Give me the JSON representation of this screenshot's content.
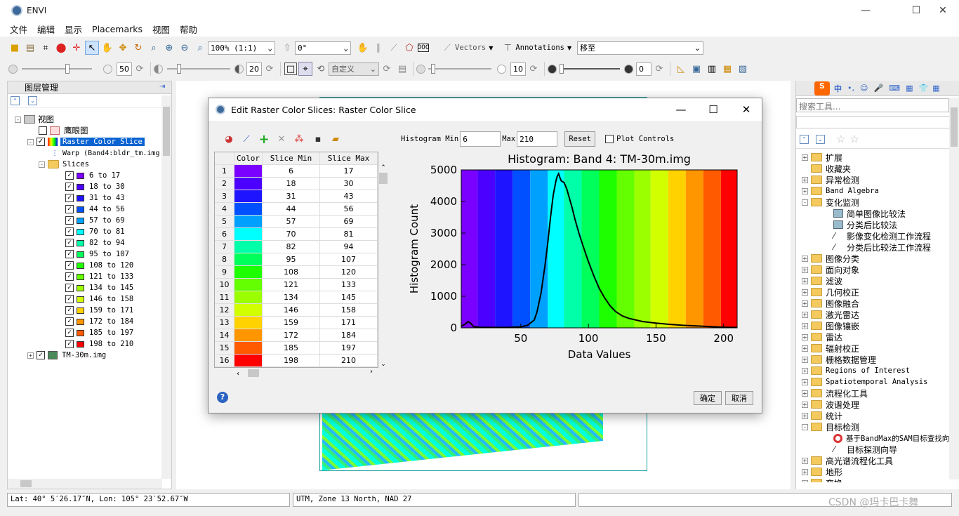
{
  "app": {
    "title": "ENVI"
  },
  "menu": [
    "文件",
    "编辑",
    "显示",
    "Placemarks",
    "视图",
    "帮助"
  ],
  "toolbar": {
    "zoom": "100% (1:1)",
    "rotation": "0°",
    "vectors": "Vectors",
    "annotations": "Annotations",
    "mode": "移至"
  },
  "toolbar2": {
    "brightness": "50",
    "contrast": "20",
    "stretch": "自定义",
    "sharpen": "10",
    "transparency": "0"
  },
  "layers": {
    "title": "图层管理",
    "root": "视图",
    "overview": "鹰眼图",
    "layer": "Raster Color Slice",
    "warp": "Warp (Band4:bldr_tm.img",
    "slices_folder": "Slices",
    "image": "TM-30m.img",
    "slices": [
      {
        "label": "6 to 17",
        "color": "#7a00ff"
      },
      {
        "label": "18 to 30",
        "color": "#4b00ff"
      },
      {
        "label": "31 to 43",
        "color": "#1e14ff"
      },
      {
        "label": "44 to 56",
        "color": "#0050ff"
      },
      {
        "label": "57 to 69",
        "color": "#00a0ff"
      },
      {
        "label": "70 to 81",
        "color": "#00ffff"
      },
      {
        "label": "82 to 94",
        "color": "#00ffa8"
      },
      {
        "label": "95 to 107",
        "color": "#00ff5a"
      },
      {
        "label": "108 to 120",
        "color": "#1eff00"
      },
      {
        "label": "121 to 133",
        "color": "#64ff00"
      },
      {
        "label": "134 to 145",
        "color": "#9bff00"
      },
      {
        "label": "146 to 158",
        "color": "#d2ff00"
      },
      {
        "label": "159 to 171",
        "color": "#ffd200"
      },
      {
        "label": "172 to 184",
        "color": "#ff9600"
      },
      {
        "label": "185 to 197",
        "color": "#ff5a00"
      },
      {
        "label": "198 to 210",
        "color": "#ff0000"
      }
    ]
  },
  "dialog": {
    "title": "Edit Raster Color Slices: Raster Color Slice",
    "hist_min_label": "Histogram Min",
    "hist_min": "6",
    "max_label": "Max",
    "max": "210",
    "reset": "Reset",
    "plot_controls": "Plot Controls",
    "col_color": "Color",
    "col_min": "Slice Min",
    "col_max": "Slice Max",
    "rows": [
      {
        "n": "1",
        "min": "6",
        "max": "17"
      },
      {
        "n": "2",
        "min": "18",
        "max": "30"
      },
      {
        "n": "3",
        "min": "31",
        "max": "43"
      },
      {
        "n": "4",
        "min": "44",
        "max": "56"
      },
      {
        "n": "5",
        "min": "57",
        "max": "69"
      },
      {
        "n": "6",
        "min": "70",
        "max": "81"
      },
      {
        "n": "7",
        "min": "82",
        "max": "94"
      },
      {
        "n": "8",
        "min": "95",
        "max": "107"
      },
      {
        "n": "9",
        "min": "108",
        "max": "120"
      },
      {
        "n": "10",
        "min": "121",
        "max": "133"
      },
      {
        "n": "11",
        "min": "134",
        "max": "145"
      },
      {
        "n": "12",
        "min": "146",
        "max": "158"
      },
      {
        "n": "13",
        "min": "159",
        "max": "171"
      },
      {
        "n": "14",
        "min": "172",
        "max": "184"
      },
      {
        "n": "15",
        "min": "185",
        "max": "197"
      },
      {
        "n": "16",
        "min": "198",
        "max": "210"
      }
    ],
    "ok": "确定",
    "cancel": "取消"
  },
  "chart_data": {
    "type": "line",
    "title": "Histogram: Band 4: TM-30m.img",
    "xlabel": "Data Values",
    "ylabel": "Histogram Count",
    "xlim": [
      6,
      210
    ],
    "ylim": [
      0,
      5000
    ],
    "xticks": [
      "50",
      "100",
      "150",
      "200"
    ],
    "yticks": [
      "0",
      "1000",
      "2000",
      "3000",
      "4000",
      "5000"
    ],
    "x": [
      6,
      9,
      11,
      13,
      15,
      20,
      30,
      40,
      50,
      55,
      60,
      62,
      65,
      68,
      70,
      72,
      74,
      76,
      77,
      78,
      79,
      80,
      82,
      84,
      86,
      88,
      90,
      93,
      96,
      100,
      104,
      108,
      112,
      116,
      120,
      125,
      130,
      140,
      150,
      160,
      170,
      180,
      190,
      200,
      210
    ],
    "y": [
      50,
      120,
      200,
      150,
      40,
      20,
      15,
      15,
      30,
      80,
      250,
      500,
      1100,
      2000,
      2700,
      3500,
      4200,
      4650,
      4800,
      4880,
      4750,
      4650,
      4600,
      4400,
      4100,
      3800,
      3450,
      3000,
      2600,
      2100,
      1650,
      1250,
      950,
      700,
      520,
      380,
      300,
      200,
      150,
      110,
      80,
      60,
      40,
      20,
      10
    ]
  },
  "tools": {
    "search_placeholder": "搜索工具...",
    "items": [
      {
        "t": "folder",
        "label": "扩展",
        "level": 0,
        "exp": "+"
      },
      {
        "t": "folder",
        "label": "收藏夹",
        "level": 0,
        "exp": ""
      },
      {
        "t": "folder",
        "label": "异常检测",
        "level": 0,
        "exp": "+"
      },
      {
        "t": "folder",
        "label": "Band Algebra",
        "level": 0,
        "exp": "+"
      },
      {
        "t": "folder",
        "label": "变化监测",
        "level": 0,
        "exp": "-"
      },
      {
        "t": "tool",
        "label": "简单图像比较法",
        "level": 1,
        "exp": ""
      },
      {
        "t": "tool",
        "label": "分类后比较法",
        "level": 1,
        "exp": ""
      },
      {
        "t": "wand",
        "label": "影像变化检测工作流程",
        "level": 1,
        "exp": ""
      },
      {
        "t": "wand",
        "label": "分类后比较法工作流程",
        "level": 1,
        "exp": ""
      },
      {
        "t": "folder",
        "label": "图像分类",
        "level": 0,
        "exp": "+"
      },
      {
        "t": "folder",
        "label": "面向对象",
        "level": 0,
        "exp": "+"
      },
      {
        "t": "folder",
        "label": "滤波",
        "level": 0,
        "exp": "+"
      },
      {
        "t": "folder",
        "label": "几何校正",
        "level": 0,
        "exp": "+"
      },
      {
        "t": "folder",
        "label": "图像融合",
        "level": 0,
        "exp": "+"
      },
      {
        "t": "folder",
        "label": "激光雷达",
        "level": 0,
        "exp": "+"
      },
      {
        "t": "folder",
        "label": "图像镶嵌",
        "level": 0,
        "exp": "+"
      },
      {
        "t": "folder",
        "label": "雷达",
        "level": 0,
        "exp": "+"
      },
      {
        "t": "folder",
        "label": "辐射校正",
        "level": 0,
        "exp": "+"
      },
      {
        "t": "folder",
        "label": "栅格数据管理",
        "level": 0,
        "exp": "+"
      },
      {
        "t": "folder",
        "label": "Regions of Interest",
        "level": 0,
        "exp": "+"
      },
      {
        "t": "folder",
        "label": "Spatiotemporal Analysis",
        "level": 0,
        "exp": "+"
      },
      {
        "t": "folder",
        "label": "流程化工具",
        "level": 0,
        "exp": "+"
      },
      {
        "t": "folder",
        "label": "波谱处理",
        "level": 0,
        "exp": "+"
      },
      {
        "t": "folder",
        "label": "统计",
        "level": 0,
        "exp": "+"
      },
      {
        "t": "folder",
        "label": "目标检测",
        "level": 0,
        "exp": "-"
      },
      {
        "t": "target",
        "label": "基于BandMax的SAM目标查找向",
        "level": 1,
        "exp": ""
      },
      {
        "t": "wand",
        "label": "目标探测向导",
        "level": 1,
        "exp": ""
      },
      {
        "t": "folder",
        "label": "高光谱流程化工具",
        "level": 0,
        "exp": "+"
      },
      {
        "t": "folder",
        "label": "地形",
        "level": 0,
        "exp": "+"
      },
      {
        "t": "folder",
        "label": "变换",
        "level": 0,
        "exp": "+"
      }
    ]
  },
  "status": {
    "coords": "Lat: 40° 5′26.17″N, Lon: 105° 23′52.67″W",
    "proj": "UTM, Zone 13 North, NAD 27",
    "watermark": "CSDN @玛卡巴卡舞"
  },
  "ime": {
    "logo": "S",
    "lang": "中"
  }
}
